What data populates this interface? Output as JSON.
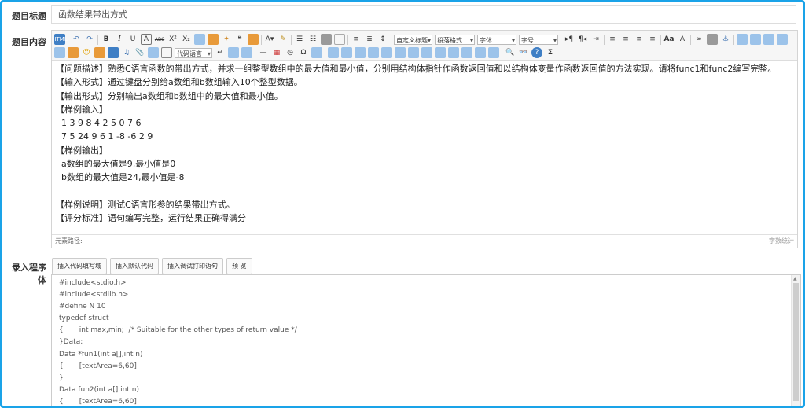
{
  "labels": {
    "title": "题目标题",
    "content": "题目内容",
    "program": "录入程序体"
  },
  "title_value": "函数结果带出方式",
  "toolbar": {
    "combos": [
      "自定义标题",
      "段落格式",
      "字体",
      "字号"
    ],
    "code_lang": "代码语言"
  },
  "content_lines": [
    "【问题描述】熟悉C语言函数的带出方式，并求一组整型数组中的最大值和最小值，分别用结构体指针作函数返回值和以结构体变量作函数返回值的方法实现。请将func1和func2编写完整。",
    "【输入形式】通过键盘分别给a数组和b数组输入10个整型数据。",
    "【输出形式】分别输出a数组和b数组中的最大值和最小值。",
    "【样例输入】",
    "  1 3 9 8 4 2 5 0 7 6",
    "  7 5 24 9 6 1 -8 -6 2 9",
    "【样例输出】",
    "  a数组的最大值是9,最小值是0",
    "  b数组的最大值是24,最小值是-8",
    "",
    "【样例说明】测试C语言形参的结果带出方式。",
    "【评分标准】语句编写完整，运行结果正确得满分"
  ],
  "status": {
    "path": "元素路径:",
    "count": "字数统计"
  },
  "tabs": [
    "插入代码填写域",
    "插入默认代码",
    "插入调试打印语句",
    "预 览"
  ],
  "code_lines": [
    "#include<stdio.h>",
    "#include<stdlib.h>",
    "#define N 10",
    "typedef struct",
    "{       int max,min;  /* Suitable for the other types of return value */",
    "}Data;",
    "Data *fun1(int a[],int n)",
    "{       [textArea=6,60]",
    "}",
    "Data fun2(int a[],int n)",
    "{       [textArea=6,60]",
    "}"
  ]
}
